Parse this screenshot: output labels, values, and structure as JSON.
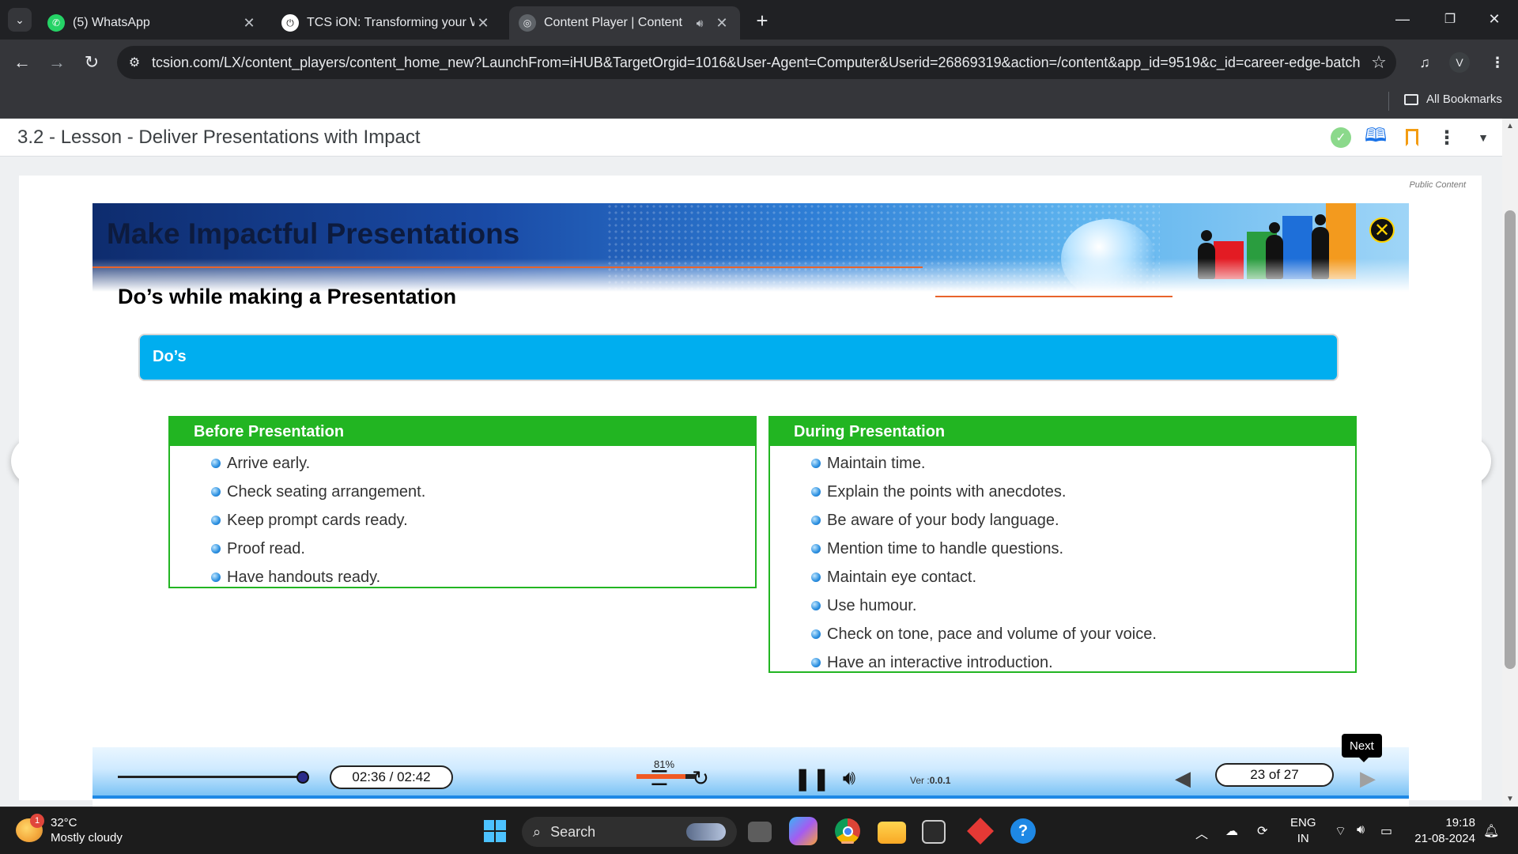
{
  "browser": {
    "tabs": [
      {
        "title": "(5) WhatsApp",
        "icon": "whatsapp-icon"
      },
      {
        "title": "TCS iON: Transforming your Wo",
        "icon": "tcs-ion-icon"
      },
      {
        "title": "Content Player | Content",
        "icon": "globe-icon",
        "audio": true,
        "active": true
      }
    ],
    "url": "tcsion.com/LX/content_players/content_home_new?LaunchFrom=iHUB&TargetOrgid=1016&User-Agent=Computer&Userid=26869319&action=/content&app_id=9519&c_id=career-edge-batch...",
    "profile_initial": "V",
    "all_bookmarks": "All Bookmarks"
  },
  "lesson": {
    "title": "3.2 - Lesson - Deliver Presentations with Impact",
    "public_content": "Public Content"
  },
  "slide": {
    "title": "Make Impactful Presentations",
    "subtitle": "Do’s while making a Presentation",
    "dos_label": "Do’s",
    "before": {
      "heading": "Before Presentation",
      "items": [
        "Arrive early.",
        "Check seating arrangement.",
        "Keep prompt cards ready.",
        "Proof read.",
        "Have handouts ready."
      ]
    },
    "during": {
      "heading": "During Presentation",
      "items": [
        "Maintain time.",
        "Explain the points with anecdotes.",
        "Be aware of your body language.",
        "Mention time to handle questions.",
        "Maintain eye contact.",
        "Use humour.",
        "Check on tone, pace and volume of your voice.",
        "Have an interactive introduction."
      ]
    }
  },
  "controls": {
    "time": "02:36 / 02:42",
    "progress_fraction": 0.96,
    "zoom": "81%",
    "zoom_fraction": 0.81,
    "version_prefix": "Ver",
    "version": "0.0.1",
    "page": "23 of 27",
    "next_tooltip": "Next"
  },
  "taskbar": {
    "temperature": "32°C",
    "weather": "Mostly cloudy",
    "notification_count": "1",
    "search_placeholder": "Search",
    "lang_top": "ENG",
    "lang_bottom": "IN",
    "time": "19:18",
    "date": "21-08-2024"
  },
  "colors": {
    "accent_green": "#22b522",
    "accent_cyan": "#00aeef",
    "banner_orange": "#e8632b"
  }
}
